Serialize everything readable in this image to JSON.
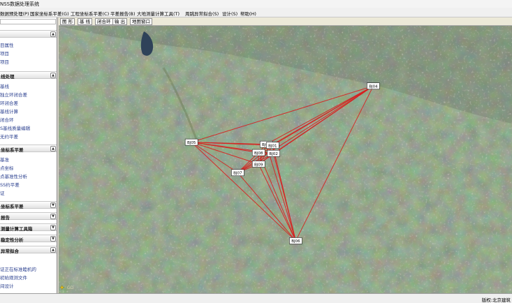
{
  "window": {
    "title": "NSS数据处理系统"
  },
  "menu": [
    {
      "label": "数据预处理(P)"
    },
    {
      "label": "国家坐标系平差(G)"
    },
    {
      "label": "工程坐标系平差(C)"
    },
    {
      "label": "平差报告(B)"
    },
    {
      "label": "大地测量计算工具(T)"
    },
    {
      "label": "周跳异常拟合(S)"
    },
    {
      "label": "设计(S)"
    },
    {
      "label": "帮助(H)"
    }
  ],
  "sidebar": {
    "top_items": [
      "目属性",
      "项目",
      "项目"
    ],
    "sections": [
      {
        "title": "线处理",
        "expanded": true,
        "items": [
          "基线",
          "独立环闭合差",
          "环闭合差",
          "基线计算",
          "闭合环",
          "S基线质量编辑",
          "无约平差"
        ]
      },
      {
        "title": "坐标系平差",
        "expanded": true,
        "items": [
          "基准",
          "点坐标",
          "点基准性分析",
          "SS约平差",
          "证"
        ]
      },
      {
        "title": "坐标系平差",
        "expanded": false,
        "items": []
      },
      {
        "title": "报告",
        "expanded": false,
        "items": []
      },
      {
        "title": "测量计算工具箱",
        "expanded": false,
        "items": []
      },
      {
        "title": "稳定性分析",
        "expanded": false,
        "items": []
      },
      {
        "title": "异常拟合",
        "expanded": true,
        "items": [
          "证正在标准睦机的",
          "初始观测文件",
          "间设计"
        ]
      }
    ]
  },
  "toolbar": {
    "buttons": [
      {
        "label": "图 形"
      },
      {
        "label": "基 线"
      },
      {
        "label": "闭合环"
      },
      {
        "label": "输 出"
      },
      {
        "label": "地图窗口"
      }
    ]
  },
  "map": {
    "stations": [
      {
        "id": "BJ04",
        "nx": 0.694,
        "ny": 0.225
      },
      {
        "id": "BJ05",
        "nx": 0.293,
        "ny": 0.435
      },
      {
        "id": "BJ03",
        "nx": 0.458,
        "ny": 0.443
      },
      {
        "id": "BJ01",
        "nx": 0.472,
        "ny": 0.447
      },
      {
        "id": "BJ08",
        "nx": 0.441,
        "ny": 0.474
      },
      {
        "id": "BJ02",
        "nx": 0.474,
        "ny": 0.477
      },
      {
        "id": "BJ09",
        "nx": 0.441,
        "ny": 0.517
      },
      {
        "id": "BJ07",
        "nx": 0.395,
        "ny": 0.549
      },
      {
        "id": "BJ06",
        "nx": 0.523,
        "ny": 0.804
      }
    ],
    "baselines": [
      [
        "BJ04",
        "BJ05"
      ],
      [
        "BJ04",
        "BJ03"
      ],
      [
        "BJ04",
        "BJ01"
      ],
      [
        "BJ04",
        "BJ08"
      ],
      [
        "BJ04",
        "BJ02"
      ],
      [
        "BJ04",
        "BJ09"
      ],
      [
        "BJ04",
        "BJ07"
      ],
      [
        "BJ04",
        "BJ06"
      ],
      [
        "BJ05",
        "BJ03"
      ],
      [
        "BJ05",
        "BJ01"
      ],
      [
        "BJ05",
        "BJ08"
      ],
      [
        "BJ05",
        "BJ02"
      ],
      [
        "BJ05",
        "BJ09"
      ],
      [
        "BJ05",
        "BJ07"
      ],
      [
        "BJ05",
        "BJ06"
      ],
      [
        "BJ03",
        "BJ01"
      ],
      [
        "BJ03",
        "BJ08"
      ],
      [
        "BJ03",
        "BJ02"
      ],
      [
        "BJ03",
        "BJ09"
      ],
      [
        "BJ03",
        "BJ06"
      ],
      [
        "BJ01",
        "BJ02"
      ],
      [
        "BJ01",
        "BJ09"
      ],
      [
        "BJ01",
        "BJ07"
      ],
      [
        "BJ01",
        "BJ06"
      ],
      [
        "BJ08",
        "BJ02"
      ],
      [
        "BJ08",
        "BJ09"
      ],
      [
        "BJ08",
        "BJ07"
      ],
      [
        "BJ08",
        "BJ06"
      ],
      [
        "BJ02",
        "BJ09"
      ],
      [
        "BJ02",
        "BJ07"
      ],
      [
        "BJ02",
        "BJ06"
      ],
      [
        "BJ09",
        "BJ07"
      ],
      [
        "BJ09",
        "BJ06"
      ],
      [
        "BJ07",
        "BJ06"
      ]
    ],
    "colors": {
      "baseline": "#d81e1e",
      "label_bg": "#ffffff",
      "label_border": "#222222"
    }
  },
  "watermark": {
    "text": "GD"
  },
  "statusbar": {
    "text": "版权:北京建筑"
  }
}
